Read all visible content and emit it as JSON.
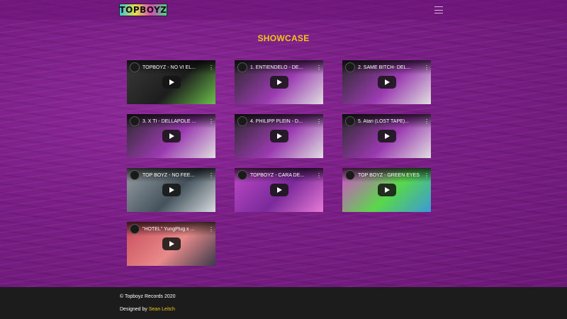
{
  "navbar": {
    "logo_text": "TOPBOYZ",
    "menu_icon": "hamburger-menu-icon"
  },
  "section": {
    "title": "SHOWCASE"
  },
  "videos": [
    {
      "title": "TOPBOYZ - NO VI EL...",
      "thumb_colors": [
        "#3a3a3a",
        "#1d1d1d",
        "#6ac04a"
      ]
    },
    {
      "title": "1. ENTIENDELO - DE...",
      "thumb_colors": [
        "#2a2a2a",
        "#9a3ab0",
        "#e0e0e0"
      ]
    },
    {
      "title": "2. SAME BITCH- DEL...",
      "thumb_colors": [
        "#2a2a2a",
        "#9a3ab0",
        "#e0e0e0"
      ]
    },
    {
      "title": "3. X TI - DELLAPOLE ...",
      "thumb_colors": [
        "#2a2a2a",
        "#9a3ab0",
        "#e0e0e0"
      ]
    },
    {
      "title": "4. PHILIPP PLEIN - D...",
      "thumb_colors": [
        "#2a2a2a",
        "#9a3ab0",
        "#e0e0e0"
      ]
    },
    {
      "title": "5. Atari (LOST TAPE)...",
      "thumb_colors": [
        "#2a2a2a",
        "#9a3ab0",
        "#e0e0e0"
      ]
    },
    {
      "title": "TOP BOYZ - NO FEE...",
      "thumb_colors": [
        "#9aa0a6",
        "#44525c",
        "#d8dde0"
      ]
    },
    {
      "title": "TOPBOYZ - CARA DE...",
      "thumb_colors": [
        "#c04ac8",
        "#7a2a9a",
        "#e87ad8"
      ]
    },
    {
      "title": "TOP BOYZ - GREEN EYES",
      "thumb_colors": [
        "#d84ad0",
        "#5ad84a",
        "#3a9ad8"
      ]
    },
    {
      "title": "\"HOTEL\" YungPlug x ...",
      "thumb_colors": [
        "#c84a5a",
        "#e88a8a",
        "#3a3a4a"
      ]
    }
  ],
  "footer": {
    "copyright": "© Topboyz Records 2020",
    "designed_by_label": "Designed by ",
    "designer_name": "Sean Leitch"
  }
}
